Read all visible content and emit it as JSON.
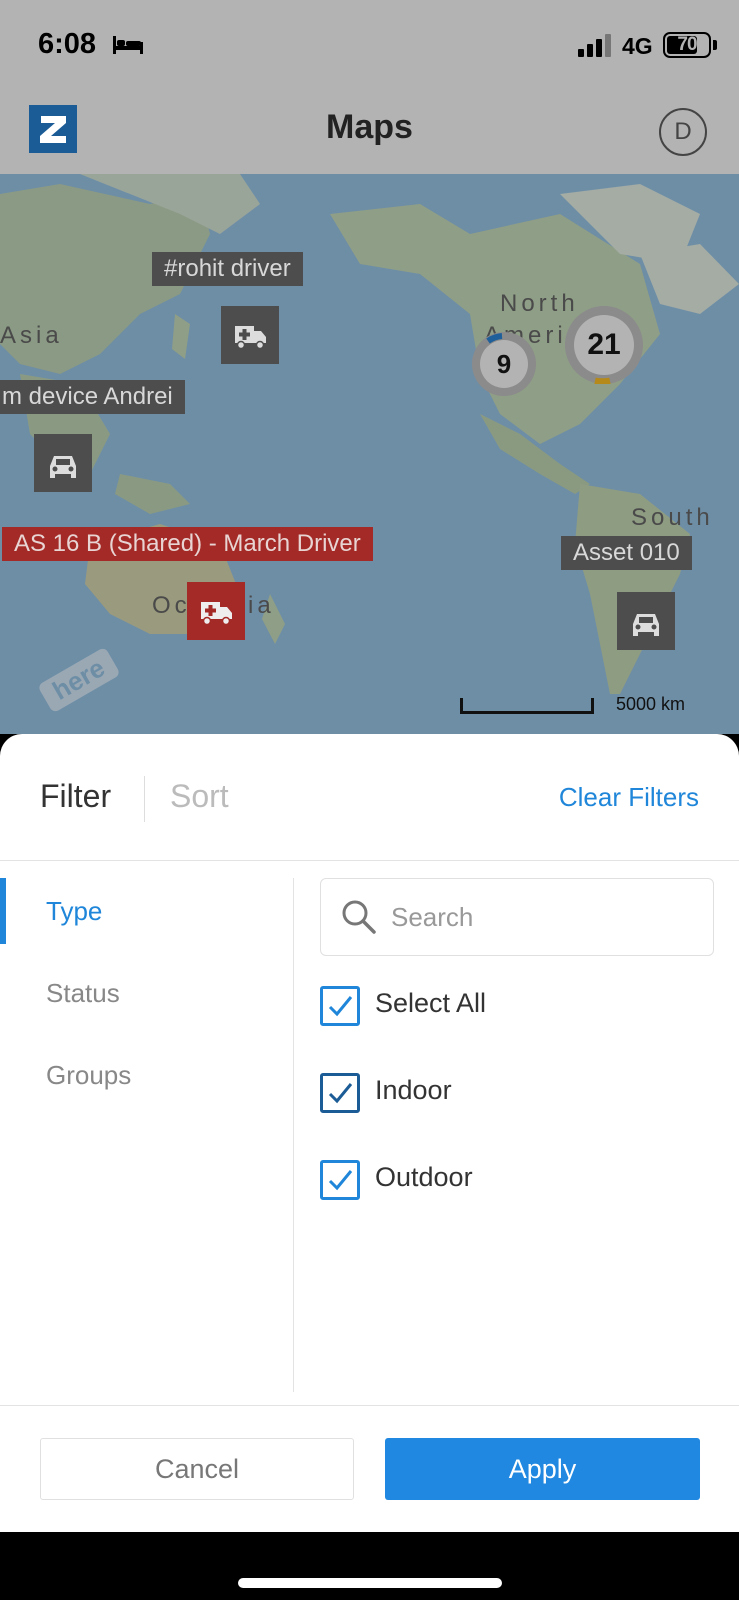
{
  "status_bar": {
    "time": "6:08",
    "network": "4G",
    "battery": "70"
  },
  "header": {
    "title": "Maps",
    "avatar_initial": "D",
    "logo_letter": "Z"
  },
  "map": {
    "region_labels": [
      "Asia",
      "North",
      "Ameri",
      "South",
      "Oc",
      "ia"
    ],
    "markers": [
      {
        "label": "#rohit driver",
        "icon": "ambulance-icon"
      },
      {
        "label": "m device Andrei",
        "icon": "car-icon"
      },
      {
        "label": "AS 16 B (Shared) - March Driver",
        "icon": "ambulance-icon",
        "status_color": "#a32a26"
      },
      {
        "label": "Asset 010",
        "icon": "car-icon"
      }
    ],
    "clusters": [
      {
        "count": "9"
      },
      {
        "count": "21"
      }
    ],
    "scale": "5000 km",
    "provider": "here"
  },
  "sheet": {
    "tabs": {
      "filter": "Filter",
      "sort": "Sort"
    },
    "clear_filters": "Clear Filters",
    "categories": [
      {
        "label": "Type",
        "active": true
      },
      {
        "label": "Status",
        "active": false
      },
      {
        "label": "Groups",
        "active": false
      }
    ],
    "search": {
      "placeholder": "Search",
      "value": ""
    },
    "options": [
      {
        "label": "Select All",
        "checked": true
      },
      {
        "label": "Indoor",
        "checked": true
      },
      {
        "label": "Outdoor",
        "checked": true
      }
    ],
    "buttons": {
      "cancel": "Cancel",
      "apply": "Apply"
    }
  },
  "colors": {
    "accent": "#2088e0",
    "marker_alert": "#a32a26",
    "marker_default": "#4d4d4d"
  }
}
